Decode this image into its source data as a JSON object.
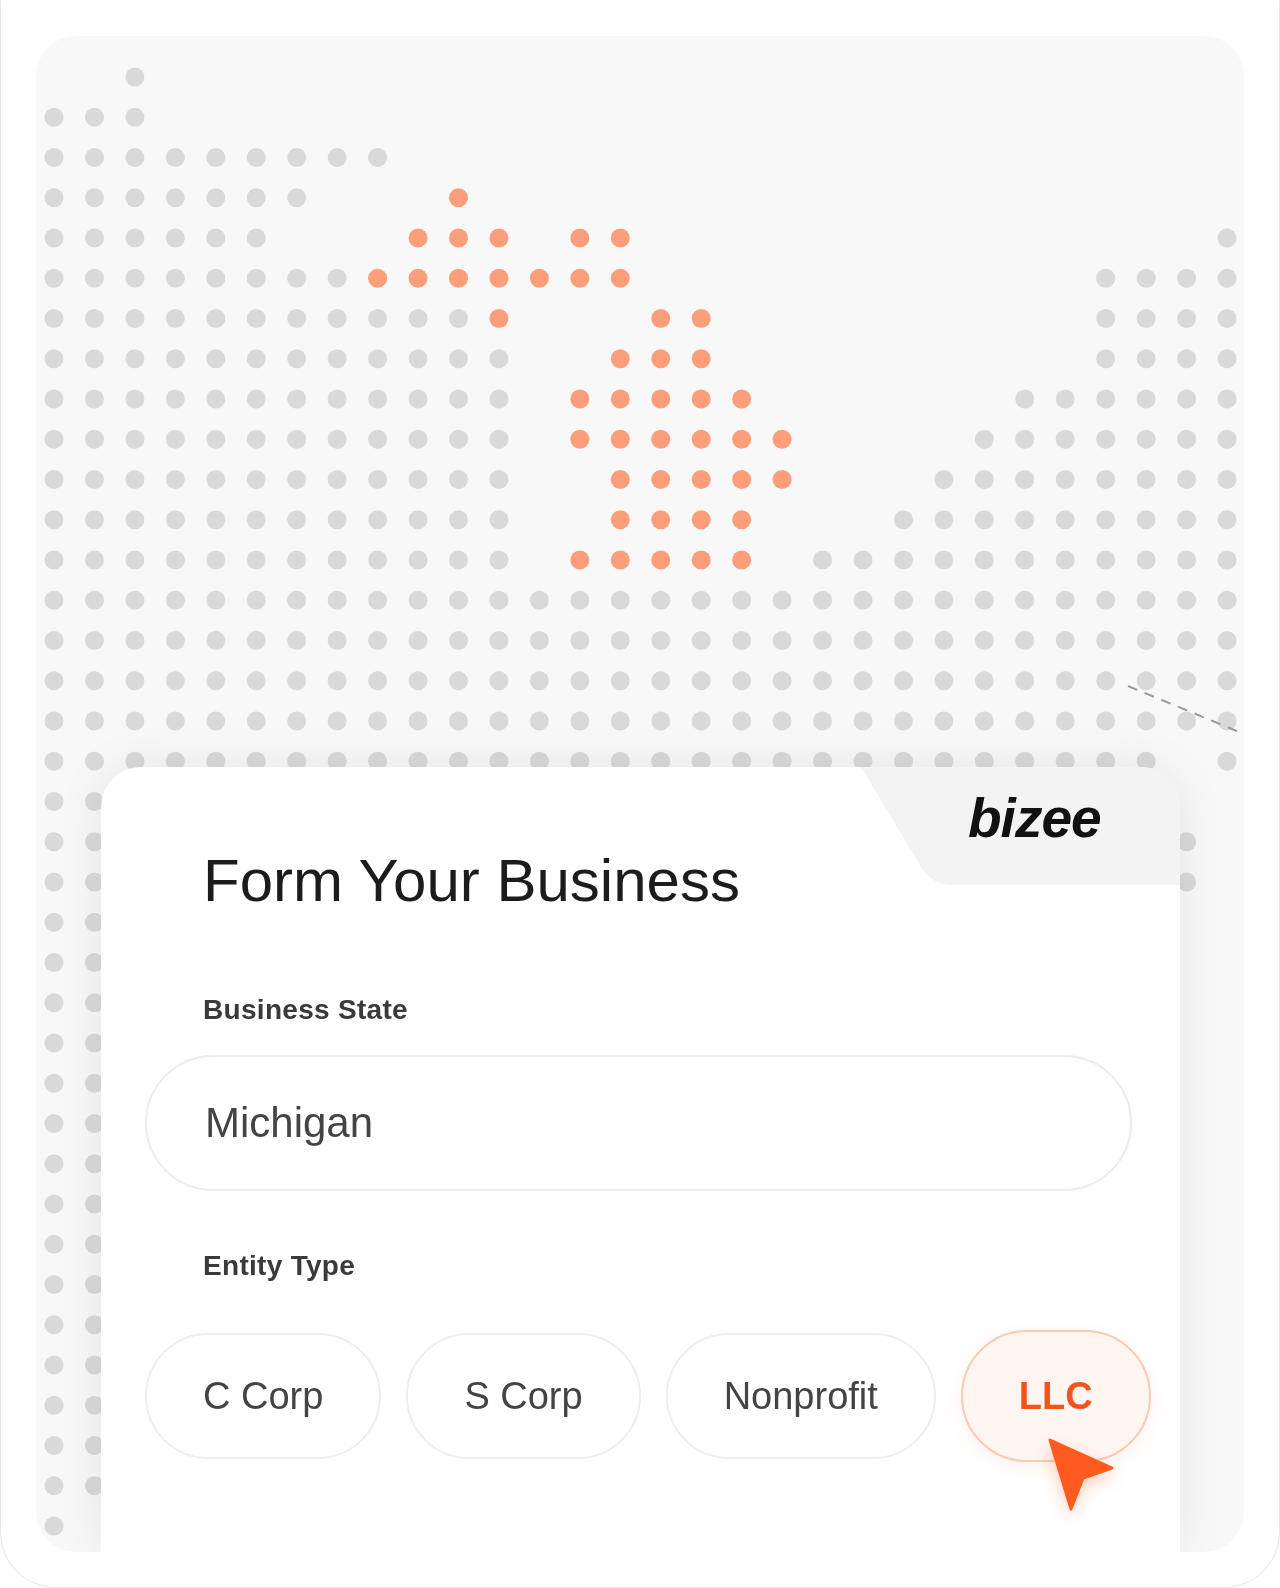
{
  "brand": {
    "logo_text": "bizee"
  },
  "form": {
    "title": "Form Your Business",
    "state_field": {
      "label": "Business State",
      "value": "Michigan"
    },
    "entity_type": {
      "label": "Entity Type",
      "options": [
        {
          "label": "C Corp",
          "selected": false
        },
        {
          "label": "S Corp",
          "selected": false
        },
        {
          "label": "Nonprofit",
          "selected": false
        },
        {
          "label": "LLC",
          "selected": true
        }
      ]
    }
  }
}
